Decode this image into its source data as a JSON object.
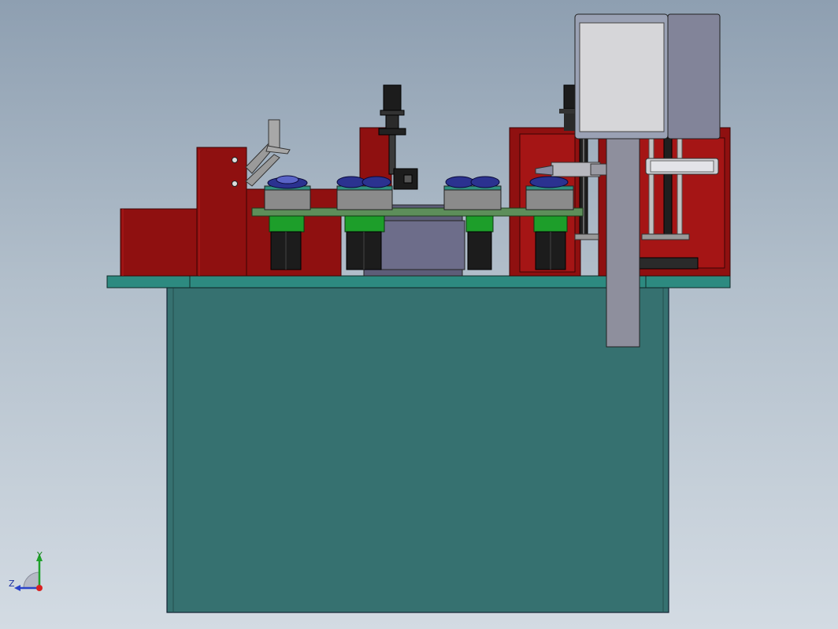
{
  "viewport": {
    "background_top": "#8e9fb1",
    "background_bottom": "#d3dbe3"
  },
  "colors": {
    "cabinet": "#367170",
    "table_top": "#2d8a80",
    "frame_red": "#8f1010",
    "frame_red_light": "#b01515",
    "conveyor_plate": "#5d8e5a",
    "collet_green": "#1d9e2a",
    "fixture_grey": "#8b8b8b",
    "part_blue": "#2b3290",
    "panel_grey": "#9aa1b4",
    "panel_screen": "#d6d6d9",
    "panel_body": "#828499",
    "slide_rail": "#b9b9c6",
    "motor_black": "#1c1c1c"
  },
  "triad": {
    "y_label": "Y",
    "z_label": "Z",
    "icon": "coordinate-triad-icon"
  }
}
